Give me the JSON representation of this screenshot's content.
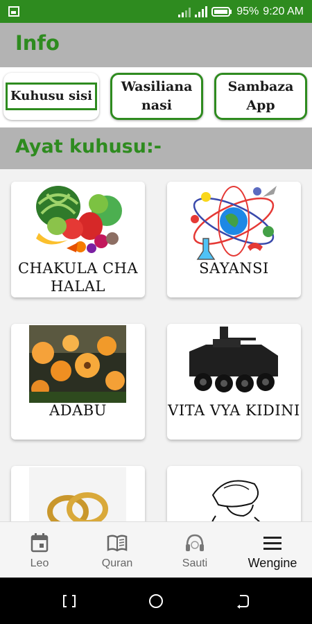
{
  "status_bar": {
    "battery": "95%",
    "time": "9:20 AM"
  },
  "header": {
    "title": "Info"
  },
  "tabs": [
    {
      "label": "Kuhusu sisi"
    },
    {
      "label": "Wasiliana nasi"
    },
    {
      "label": "Sambaza App"
    }
  ],
  "section": {
    "title": "Ayat kuhusu:-"
  },
  "cards": [
    {
      "label": "CHAKULA CHA HALAL",
      "icon": "fruits-vegetables-image"
    },
    {
      "label": "SAYANSI",
      "icon": "science-image"
    },
    {
      "label": "ADABU",
      "icon": "flowers-image"
    },
    {
      "label": "VITA VYA KIDINI",
      "icon": "armored-vehicle-image"
    },
    {
      "label": "",
      "icon": "wedding-rings-image"
    },
    {
      "label": "",
      "icon": "sketch-figure-image"
    }
  ],
  "bottom_nav": [
    {
      "label": "Leo",
      "icon": "calendar-icon"
    },
    {
      "label": "Quran",
      "icon": "book-icon"
    },
    {
      "label": "Sauti",
      "icon": "headphones-icon"
    },
    {
      "label": "Wengine",
      "icon": "menu-icon",
      "active": true
    }
  ],
  "colors": {
    "brand": "#2e8b1f",
    "header_bg": "#b3b3b3"
  }
}
